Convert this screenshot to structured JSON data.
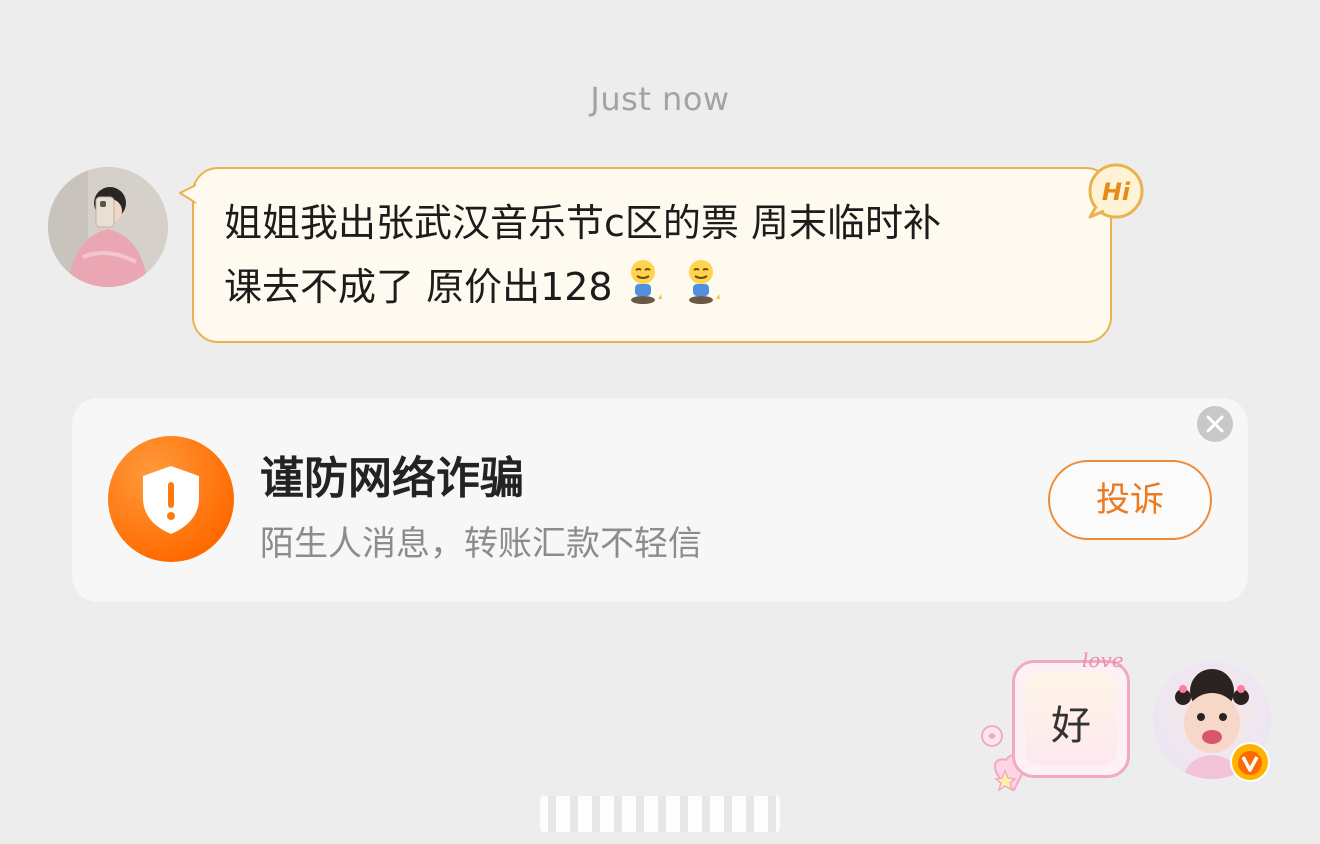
{
  "timestamp": "Just now",
  "message_in": {
    "line1": "姐姐我出张武汉音乐节c区的票 周末临时补",
    "line2": "课去不成了 原价出128",
    "emoji_count": 2,
    "badge_text": "Hi"
  },
  "warning_card": {
    "title": "谨防网络诈骗",
    "subtitle": "陌生人消息，转账汇款不轻信",
    "report_label": "投诉",
    "icon": "shield-alert-icon",
    "accent": "#ff7a0d"
  },
  "message_out": {
    "text": "好",
    "deco_text": "love"
  },
  "colors": {
    "background": "#ededed",
    "bubble_border": "#e9b24f",
    "bubble_fill": "#fffaf0"
  }
}
